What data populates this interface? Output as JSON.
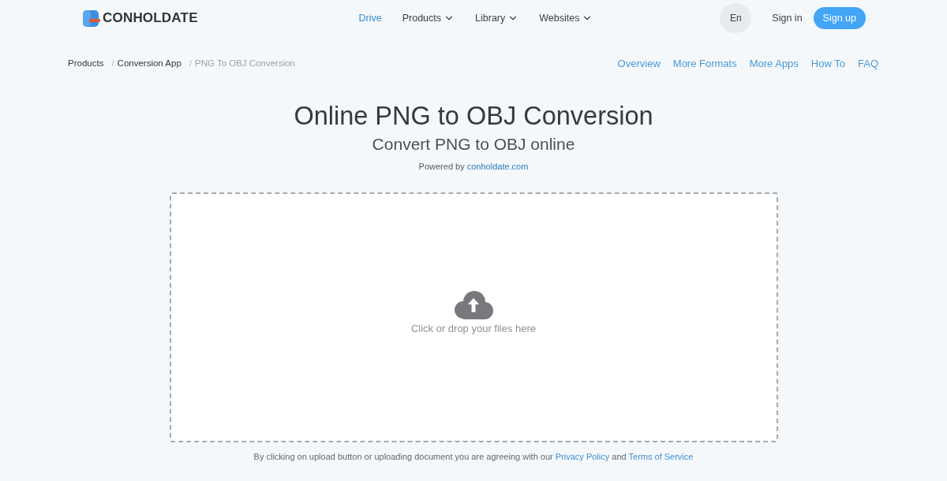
{
  "header": {
    "logo": "CONHOLDATE",
    "nav": [
      {
        "label": "Drive",
        "selected": true,
        "dropdown": false
      },
      {
        "label": "Products",
        "selected": false,
        "dropdown": true
      },
      {
        "label": "Library",
        "selected": false,
        "dropdown": true
      },
      {
        "label": "Websites",
        "selected": false,
        "dropdown": true
      }
    ],
    "language": "En",
    "sign_in": "Sign in",
    "sign_up": "Sign up"
  },
  "breadcrumb": [
    {
      "label": "Products",
      "current": false
    },
    {
      "separator": "/",
      "label": "Conversion App",
      "current": false
    },
    {
      "separator": "/",
      "label": "PNG To OBJ Conversion",
      "current": true
    }
  ],
  "section_links": [
    "Overview",
    "More Formats",
    "More Apps",
    "How To",
    "FAQ"
  ],
  "hero": {
    "title": "Online PNG to OBJ Conversion",
    "subtitle": "Convert PNG to OBJ online",
    "powered_by": [
      {
        "kind": "text",
        "text": "Powered by"
      },
      {
        "kind": "link",
        "text": "conholdate.com"
      }
    ]
  },
  "upload": {
    "prompt": "Click or drop your files here"
  },
  "consent": [
    {
      "kind": "text",
      "text": "By clicking on upload button or uploading document you are agreeing with our"
    },
    {
      "kind": "link",
      "text": "Privacy Policy"
    },
    {
      "kind": "text",
      "text": "and"
    },
    {
      "kind": "link",
      "text": "Terms of Service"
    }
  ]
}
